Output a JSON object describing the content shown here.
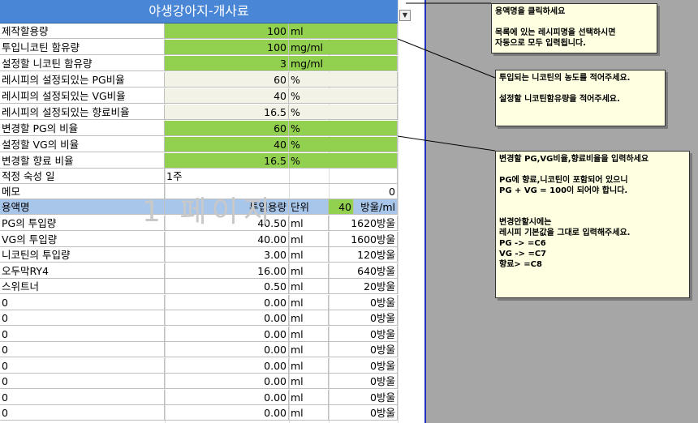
{
  "title": "야생강아지-개사료",
  "watermark": "1 페이지",
  "params": [
    {
      "label": "제작할용량",
      "value": "100",
      "unit": "ml",
      "bg": "green"
    },
    {
      "label": "투입니코틴 함유량",
      "value": "100",
      "unit": "mg/ml",
      "bg": "green"
    },
    {
      "label": "설정할 니코틴 함유량",
      "value": "3",
      "unit": "mg/ml",
      "bg": "green"
    },
    {
      "label": "레시피의 설정되있는 PG비율",
      "value": "60",
      "unit": "%",
      "bg": "beige"
    },
    {
      "label": "레시피의 설정되있는 VG비율",
      "value": "40",
      "unit": "%",
      "bg": "beige"
    },
    {
      "label": "레시피의 설정되있는 향료비율",
      "value": "16.5",
      "unit": "%",
      "bg": "beige"
    },
    {
      "label": "변경할 PG의 비율",
      "value": "60",
      "unit": "%",
      "bg": "green"
    },
    {
      "label": "설정할 VG의 비율",
      "value": "40",
      "unit": "%",
      "bg": "green"
    },
    {
      "label": "변경할 향료 비율",
      "value": "16.5",
      "unit": "%",
      "bg": "green"
    }
  ],
  "aging": {
    "label": "적정 숙성 일",
    "value": "1주"
  },
  "memo": {
    "label": "메모",
    "value": "0"
  },
  "header": {
    "name": "용액명",
    "amount": "투입용량",
    "unit": "단위",
    "drops_value": "40",
    "drops_unit": "방울/ml"
  },
  "rows": [
    {
      "name": "PG의 투입량",
      "amount": "40.50",
      "unit": "ml",
      "drops": "1620방울"
    },
    {
      "name": "VG의 투입량",
      "amount": "40.00",
      "unit": "ml",
      "drops": "1600방울"
    },
    {
      "name": "니코틴의 투입량",
      "amount": "3.00",
      "unit": "ml",
      "drops": "120방울"
    },
    {
      "name": "오두막RY4",
      "amount": "16.00",
      "unit": "ml",
      "drops": "640방울"
    },
    {
      "name": "스위트너",
      "amount": "0.50",
      "unit": "ml",
      "drops": "20방울"
    },
    {
      "name": "0",
      "amount": "0.00",
      "unit": "ml",
      "drops": "0방울"
    },
    {
      "name": "0",
      "amount": "0.00",
      "unit": "ml",
      "drops": "0방울"
    },
    {
      "name": "0",
      "amount": "0.00",
      "unit": "ml",
      "drops": "0방울"
    },
    {
      "name": "0",
      "amount": "0.00",
      "unit": "ml",
      "drops": "0방울"
    },
    {
      "name": "0",
      "amount": "0.00",
      "unit": "ml",
      "drops": "0방울"
    },
    {
      "name": "0",
      "amount": "0.00",
      "unit": "ml",
      "drops": "0방울"
    },
    {
      "name": "0",
      "amount": "0.00",
      "unit": "ml",
      "drops": "0방울"
    },
    {
      "name": "0",
      "amount": "0.00",
      "unit": "ml",
      "drops": "0방울"
    }
  ],
  "notes": [
    "용액명을 클릭하세요\n\n목록에 있는 레시피명을 선택하시면\n자동으로 모두 입력됩니다.",
    "투입되는 니코틴의 농도를 적어주세요.\n\n설정할 니코틴함유량을 적어주세요.",
    "변경할 PG,VG비율,향료비율을 입력하세요\n\nPG에 향료,니코틴이 포함되어 있으니\nPG + VG = 100이 되어야 합니다.\n\n\n변경안할시에는\n레시피 기본값을 그대로 입력해주세요.\nPG -> =C6\nVG -> =C7\n향료> =C8"
  ],
  "colors": {
    "green": "#92d050",
    "beige": "#f2f2e6",
    "title": "#4a86d6",
    "header": "#a8c5ea",
    "note": "#ffffe1"
  },
  "icons": {
    "dropdown": "chevron-down-icon"
  }
}
